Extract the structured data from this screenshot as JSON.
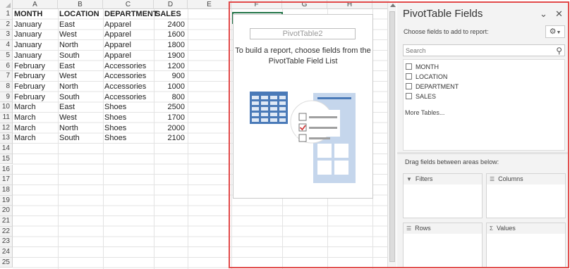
{
  "grid": {
    "columns": [
      "A",
      "B",
      "C",
      "D",
      "E",
      "F",
      "G",
      "H"
    ],
    "rows": [
      "1",
      "2",
      "3",
      "4",
      "5",
      "6",
      "7",
      "8",
      "9",
      "10",
      "11",
      "12",
      "13",
      "14",
      "15",
      "16",
      "17",
      "18",
      "19",
      "20",
      "21",
      "22",
      "23",
      "24",
      "25"
    ],
    "headers": [
      "MONTH",
      "LOCATION",
      "DEPARTMENT",
      "SALES"
    ],
    "data": [
      [
        "January",
        "East",
        "Apparel",
        "2400"
      ],
      [
        "January",
        "West",
        "Apparel",
        "1600"
      ],
      [
        "January",
        "North",
        "Apparel",
        "1800"
      ],
      [
        "January",
        "South",
        "Apparel",
        "1900"
      ],
      [
        "February",
        "East",
        "Accessories",
        "1200"
      ],
      [
        "February",
        "West",
        "Accessories",
        "900"
      ],
      [
        "February",
        "North",
        "Accessories",
        "1000"
      ],
      [
        "February",
        "South",
        "Accessories",
        "800"
      ],
      [
        "March",
        "East",
        "Shoes",
        "2500"
      ],
      [
        "March",
        "West",
        "Shoes",
        "1700"
      ],
      [
        "March",
        "North",
        "Shoes",
        "2000"
      ],
      [
        "March",
        "South",
        "Shoes",
        "2100"
      ]
    ]
  },
  "pivot": {
    "name": "PivotTable2",
    "message_line1": "To build a report, choose fields from the",
    "message_line2": "PivotTable Field List"
  },
  "pane": {
    "title": "PivotTable Fields",
    "chevron_icon": "chevron-down-icon",
    "close_icon": "close-icon",
    "subtitle": "Choose fields to add to report:",
    "gear_icon": "gear-icon",
    "search_placeholder": "Search",
    "fields": [
      "MONTH",
      "LOCATION",
      "DEPARTMENT",
      "SALES"
    ],
    "more_tables": "More Tables...",
    "areas_label": "Drag fields between areas below:",
    "areas": {
      "filters": "Filters",
      "columns": "Columns",
      "rows": "Rows",
      "values": "Values"
    }
  },
  "colors": {
    "highlight": "#e24a4a",
    "selection": "#217346",
    "illustration_blue": "#4a7ab8"
  }
}
